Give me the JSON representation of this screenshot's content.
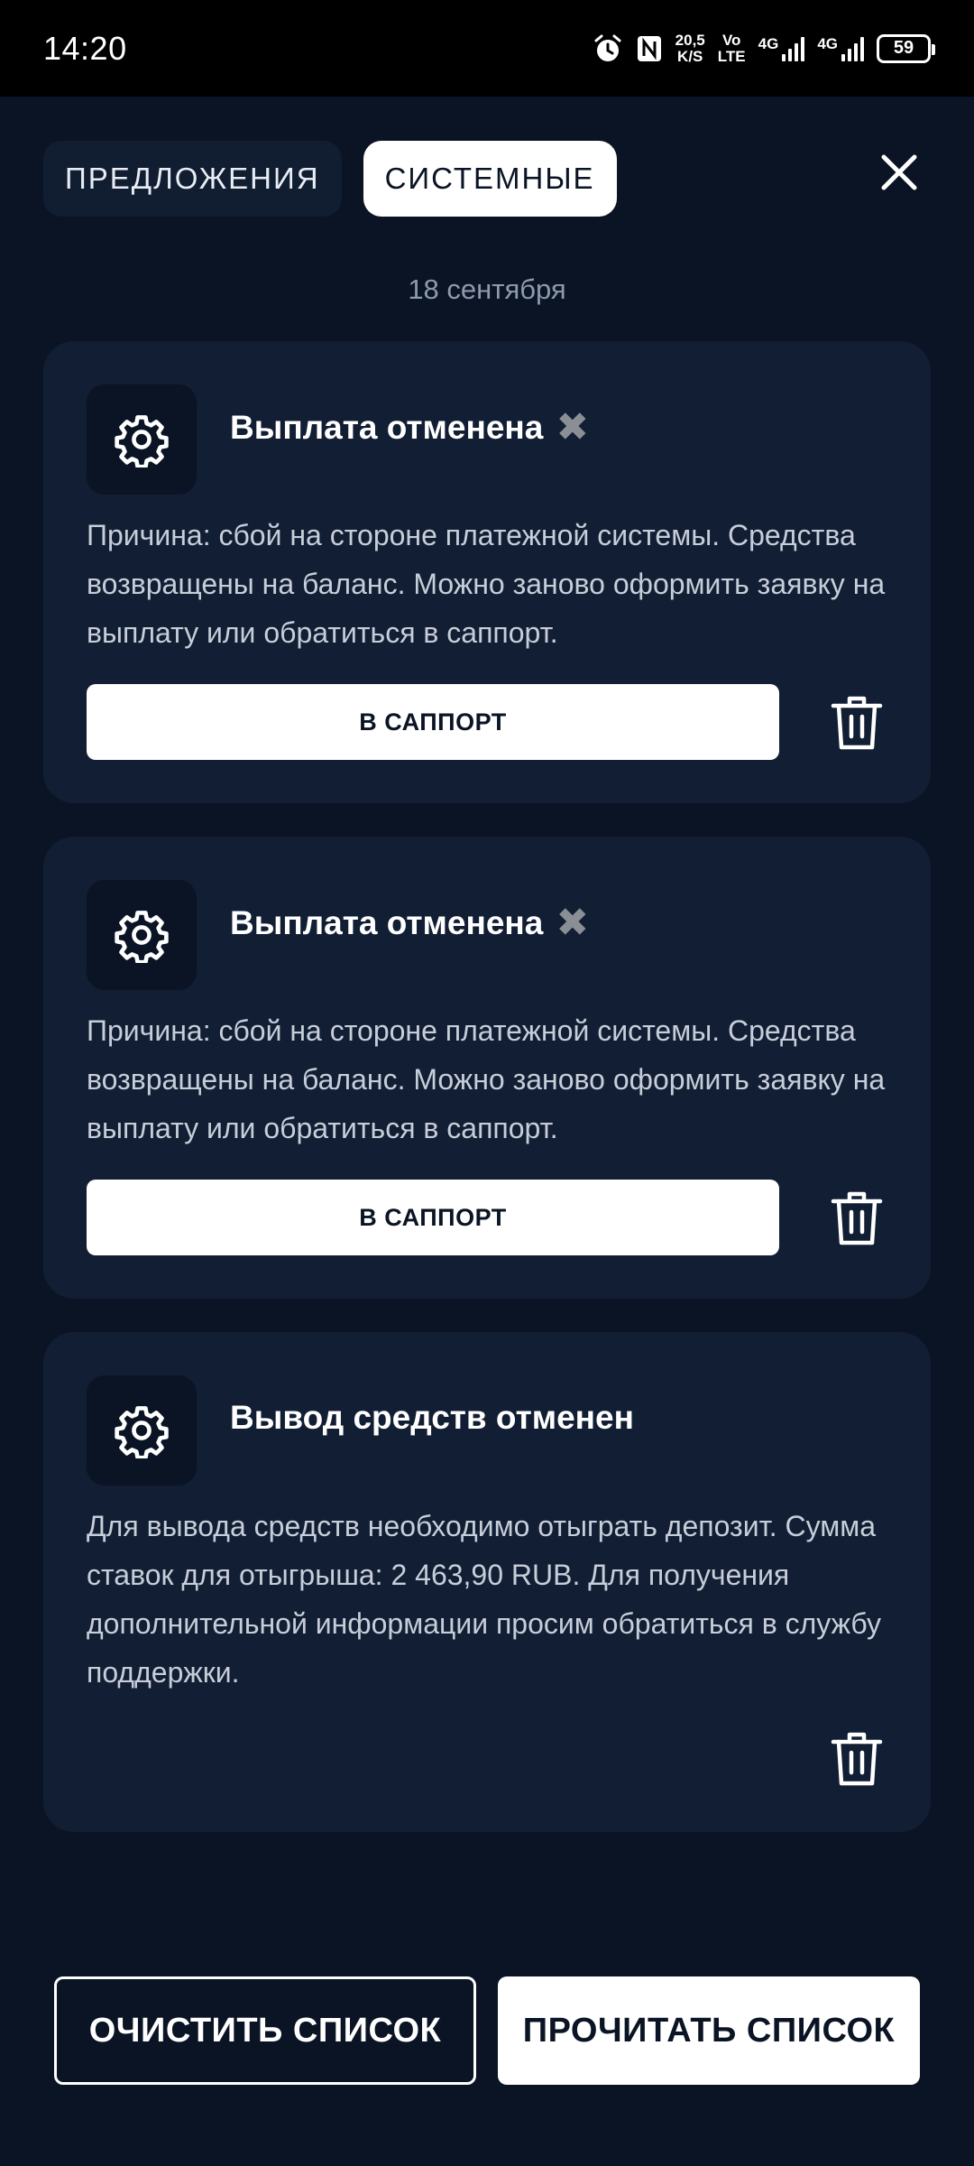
{
  "status_bar": {
    "time": "14:20",
    "net_speed_value": "20,5",
    "net_speed_unit": "K/S",
    "volte_top": "Vo",
    "volte_bottom": "LTE",
    "net1": "4G",
    "net2": "4G",
    "battery": "59"
  },
  "tabs": [
    {
      "label": "ПРЕДЛОЖЕНИЯ",
      "active": false
    },
    {
      "label": "СИСТЕМНЫЕ",
      "active": true
    }
  ],
  "date_label": "18 сентября",
  "notifications": [
    {
      "title": "Выплата отменена",
      "title_emoji": "✖",
      "body": "Причина: сбой на стороне платежной системы. Средства возвращены на баланс. Можно заново оформить заявку на выплату или обратиться в саппорт.",
      "button_label": "В САППОРТ"
    },
    {
      "title": "Выплата отменена",
      "title_emoji": "✖",
      "body": "Причина: сбой на стороне платежной системы. Средства возвращены на баланс. Можно заново оформить заявку на выплату или обратиться в саппорт.",
      "button_label": "В САППОРТ"
    },
    {
      "title": "Вывод средств отменен",
      "body": "Для вывода средств необходимо отыграть депозит. Сумма ставок для отыгрыша: 2 463,90 RUB. Для получения дополнительной информации просим обратиться в службу поддержки."
    }
  ],
  "bottom": {
    "clear_label": "ОЧИСТИТЬ СПИСОК",
    "read_label": "ПРОЧИТАТЬ СПИСОК"
  },
  "colors": {
    "background": "#0a1424",
    "card": "#111e33",
    "accent": "#ffffff",
    "muted_text": "#8d99ad"
  }
}
